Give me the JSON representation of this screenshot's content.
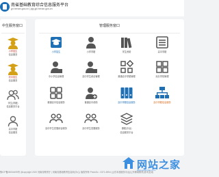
{
  "header": {
    "title": "南省基础教育综合信息服务平台",
    "url_line": "jyt.henan.gov.cn | jcjy.jyt.henan.gov.cn"
  },
  "left_panel": {
    "title": "中生服务窗口",
    "items": [
      {
        "label_1": "小学招生",
        "label_2": "信息服务",
        "icon": "graduate-person-icon",
        "color": "#d4a017"
      },
      {
        "label_1": "初中招生",
        "label_2": "信息服务",
        "icon": "graduate-person-icon",
        "color": "#d4a017"
      },
      {
        "label_1": "学生(学籍)",
        "label_2": "信息服务平台",
        "icon": "users-outline-icon",
        "color": "#666666"
      },
      {
        "label_1": "高中学籍",
        "label_2": "信息服务",
        "icon": "user-outline-icon",
        "color": "#666666"
      }
    ]
  },
  "right_panel": {
    "title": "管理服务窗口",
    "rows": [
      [
        {
          "label": "小学招生",
          "icon": "graduation-cap-icon",
          "color": "#1f6fb5"
        },
        {
          "label": "小学学籍",
          "icon": "person-icon",
          "color": "#555555"
        },
        {
          "label": "学生资助",
          "icon": "books-icon",
          "color": "#555555"
        },
        {
          "label": "高中学籍",
          "icon": "list-icon",
          "color": "#555555"
        }
      ],
      [
        {
          "label": "中小学信息管理",
          "icon": "person-badge-icon",
          "color": "#555555"
        },
        {
          "label": "高中学生综合管理",
          "icon": "person-badge-icon",
          "color": "#555555"
        },
        {
          "label": "普通高中学籍管理",
          "icon": "diamond-grid-icon",
          "color": "#555555"
        },
        {
          "label": "民办学校管理",
          "icon": "blocks-icon",
          "color": "#555555"
        }
      ],
      [
        {
          "label": "普通高中信息服务",
          "icon": "grid-icon",
          "color": "#555555"
        },
        {
          "label": "普通高中资助",
          "icon": "person-plus-icon",
          "color": "#555555"
        },
        {
          "label": "高中学籍信息服务",
          "icon": "binders-icon",
          "color": "#1f6fb5"
        },
        {
          "label": "高中学籍信息服务",
          "icon": "network-icon",
          "color": "#d4691c"
        }
      ],
      [
        {
          "label": "高中学生发展综合服务",
          "icon": "people-icon",
          "color": "#555555"
        },
        {
          "label": "高中学生发展服务",
          "icon": "people-icon",
          "color": "#555555"
        },
        {
          "label": "课程(平台)",
          "sublabel": "信息服务平台",
          "icon": "stack-icon",
          "color": "#555555"
        }
      ]
    ]
  },
  "footer": {
    "text": "豫ICP备05004495号 @copyright 2020 河南省教育厅 | 河南省基础教育信息网(中心) 版权所有   PhotoSo : 0371-6954 (山东本浪服务平台(山东聊城教育)技术支持)"
  },
  "watermark": {
    "text": "网站之家",
    "sub": "www.wangzhan.com"
  }
}
